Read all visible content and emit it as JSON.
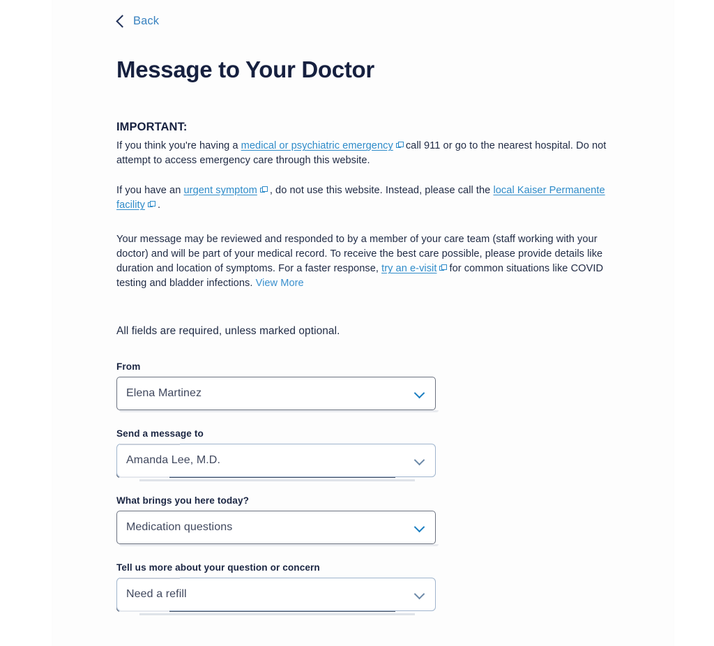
{
  "nav": {
    "back_label": "Back",
    "back_icon": "chevron-left-icon"
  },
  "header": {
    "title": "Message to Your Doctor"
  },
  "important": {
    "heading": "IMPORTANT:",
    "paragraph1": {
      "before_link": "If you think you're having a ",
      "link": "medical or psychiatric emergency",
      "after_link": "call 911 or go to the nearest hospital. Do not attempt to access emergency care through this website."
    },
    "paragraph2": {
      "before_link1": "If you have an ",
      "link1": "urgent symptom",
      "between": ", do not use this website. Instead, please call the ",
      "link2": "local Kaiser Permanente facility",
      "after_link2": "."
    },
    "paragraph3": {
      "before_link": "Your message may be reviewed and responded to by a member of your care team (staff working with your doctor) and will be part of your medical record. To receive the best care possible, please provide details like duration and location of symptoms. For a faster response, ",
      "link": "try an e-visit",
      "between": "for common situations like COVID testing and bladder infections. ",
      "view_more": "View More"
    },
    "required_note": "All fields are required, unless marked optional."
  },
  "form": {
    "fields": [
      {
        "label": "From",
        "value": "Elena Martinez",
        "style": "default",
        "icon": "chevron-down-icon"
      },
      {
        "label": "Send a message to",
        "value": "Amanda Lee, M.D.",
        "style": "alt",
        "icon": "chevron-down-icon"
      },
      {
        "label": "What brings you here today?",
        "value": "Medication questions",
        "style": "default",
        "icon": "chevron-down-icon"
      },
      {
        "label": "Tell us more about your question or concern",
        "value": "Need a refill",
        "style": "alt",
        "icon": "chevron-down-icon"
      }
    ]
  },
  "colors": {
    "link_blue": "#2E8BC9",
    "accent_blue": "#3A83C0",
    "title_navy": "#16203f",
    "chevron_blue": "#1a7ec1",
    "body_text": "#1f2a44"
  }
}
